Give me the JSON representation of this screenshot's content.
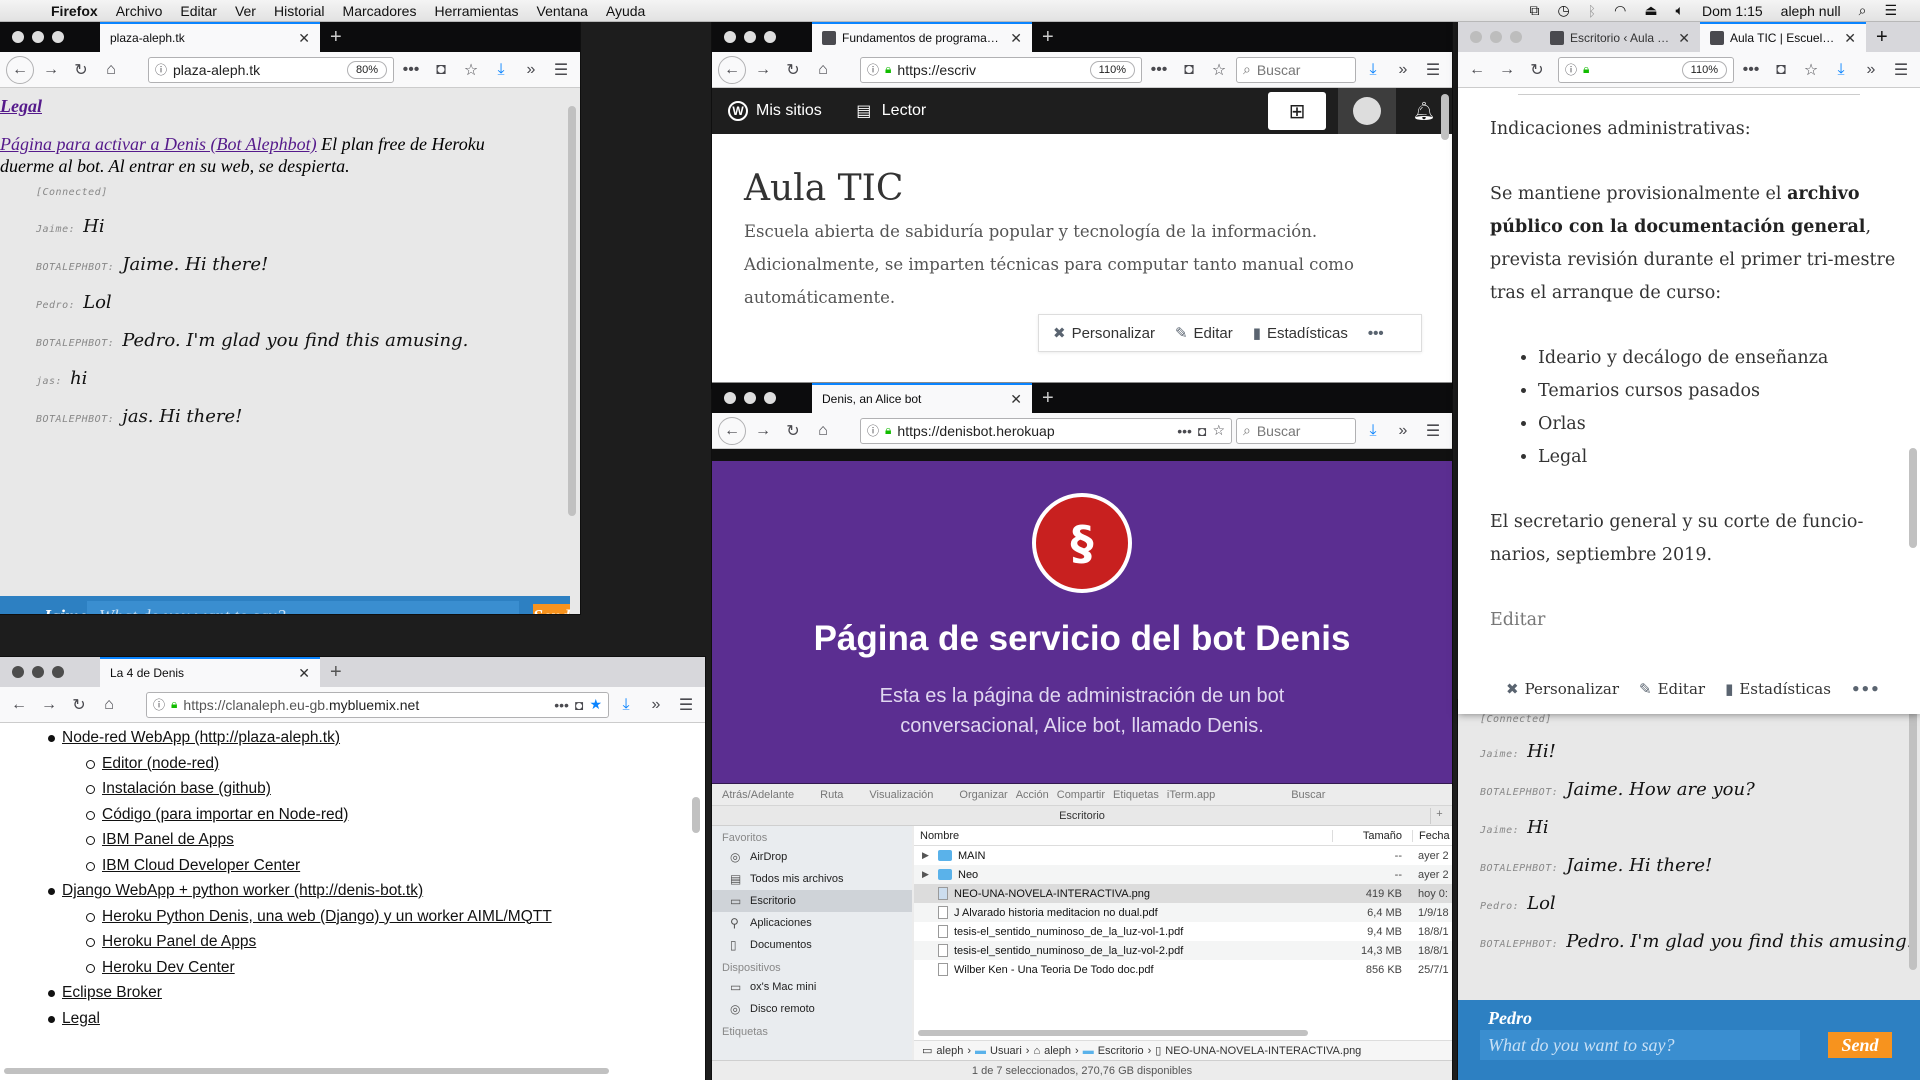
{
  "menubar": {
    "app": "Firefox",
    "items": [
      "Archivo",
      "Editar",
      "Ver",
      "Historial",
      "Marcadores",
      "Herramientas",
      "Ventana",
      "Ayuda"
    ],
    "clock": "Dom 1:15",
    "user": "aleph null"
  },
  "win_chat_left": {
    "tab": "plaza-aleph.tk",
    "url": "plaza-aleph.tk",
    "zoom": "80%",
    "legal_link": "Legal",
    "activate_link": "Página para activar a Denis (Bot Alephbot)",
    "note": " El plan free de Heroku duerme al bot. Al entrar en su web, se despierta.",
    "connected": "[Connected]",
    "messages": [
      {
        "nick": "Jaime:",
        "text": "Hi"
      },
      {
        "nick": "BOTALEPHBOT:",
        "text": "Jaime. Hi there!"
      },
      {
        "nick": "Pedro:",
        "text": "Lol"
      },
      {
        "nick": "BOTALEPHBOT:",
        "text": "Pedro. I'm glad you find this amusing."
      },
      {
        "nick": "jas:",
        "text": "hi"
      },
      {
        "nick": "BOTALEPHBOT:",
        "text": "jas. Hi there!"
      }
    ],
    "form": {
      "nick": "Jaime",
      "placeholder": "What do you want to say?",
      "send": "Send"
    }
  },
  "win_wp": {
    "tab": "Fundamentos de programación",
    "url": "https://escriv",
    "zoom": "110%",
    "search": "Buscar",
    "bar": {
      "my_sites": "Mis sitios",
      "reader": "Lector"
    },
    "title": "Aula TIC",
    "desc": "Escuela abierta de sabiduría popular y tecnología de la información. Adicionalmente, se imparten técnicas para computar tanto manual como automáticamente.",
    "footer": {
      "customize": "Personalizar",
      "edit": "Editar",
      "stats": "Estadísticas"
    }
  },
  "win_denis": {
    "tab": "Denis, an Alice bot",
    "url": "https://denisbot.herokuap",
    "search": "Buscar",
    "heading": "Página de servicio del bot Denis",
    "sub": "Esta es la página de administración de un bot conversacional, Alice bot, llamado Denis."
  },
  "win_finder": {
    "toolbar": [
      "Atrás/Adelante",
      "Ruta",
      "Visualización",
      "Organizar",
      "Acción",
      "Compartir",
      "Etiquetas",
      "iTerm.app",
      "Buscar"
    ],
    "title": "Escritorio",
    "sidebar": {
      "favorites_header": "Favoritos",
      "favorites": [
        "AirDrop",
        "Todos mis archivos",
        "Escritorio",
        "Aplicaciones",
        "Documentos"
      ],
      "devices_header": "Dispositivos",
      "devices": [
        "ox's Mac mini",
        "Disco remoto"
      ],
      "tags_header": "Etiquetas"
    },
    "columns": {
      "name": "Nombre",
      "size": "Tamaño",
      "date": "Fecha"
    },
    "rows": [
      {
        "name": "MAIN",
        "size": "--",
        "date": "ayer 2",
        "type": "folder"
      },
      {
        "name": "Neo",
        "size": "--",
        "date": "ayer 2",
        "type": "folder"
      },
      {
        "name": "NEO-UNA-NOVELA-INTERACTIVA.png",
        "size": "419 KB",
        "date": "hoy 0:",
        "type": "img"
      },
      {
        "name": "J Alvarado historia meditacion no dual.pdf",
        "size": "6,4 MB",
        "date": "1/9/18",
        "type": "doc"
      },
      {
        "name": "tesis-el_sentido_numinoso_de_la_luz-vol-1.pdf",
        "size": "9,4 MB",
        "date": "18/8/1",
        "type": "doc"
      },
      {
        "name": "tesis-el_sentido_numinoso_de_la_luz-vol-2.pdf",
        "size": "14,3 MB",
        "date": "18/8/1",
        "type": "doc"
      },
      {
        "name": "Wilber Ken - Una Teoria De Todo doc.pdf",
        "size": "856 KB",
        "date": "25/7/1",
        "type": "doc"
      }
    ],
    "breadcrumb": [
      "aleph",
      "Usuari",
      "aleph",
      "Escritorio",
      "NEO-UNA-NOVELA-INTERACTIVA.png"
    ],
    "status": "1 de 7 seleccionados, 270,76 GB disponibles"
  },
  "win_links": {
    "tab": "La 4 de Denis",
    "url_pre": "https://clanaleph.eu-gb.",
    "url_host": "mybluemix.net",
    "items": [
      {
        "level": 1,
        "text": "Node-red WebApp (http://plaza-aleph.tk)"
      },
      {
        "level": 2,
        "text": "Editor (node-red)"
      },
      {
        "level": 2,
        "text": "Instalación base (github)"
      },
      {
        "level": 2,
        "text": "Código (para importar en Node-red)"
      },
      {
        "level": 2,
        "text": "IBM Panel de Apps"
      },
      {
        "level": 2,
        "text": "IBM Cloud Developer Center"
      },
      {
        "level": 1,
        "text": "Django WebApp + python worker (http://denis-bot.tk)"
      },
      {
        "level": 2,
        "text": "Heroku Python Denis, una web (Django) y un worker AIML/MQTT"
      },
      {
        "level": 2,
        "text": "Heroku Panel de Apps"
      },
      {
        "level": 2,
        "text": "Heroku Dev Center"
      },
      {
        "level": 1,
        "text": "Eclipse Broker"
      },
      {
        "level": 1,
        "text": "Legal"
      }
    ]
  },
  "win_right": {
    "tab1": "Escritorio ‹ Aula TIC",
    "tab2": "Aula TIC | Escuela a",
    "zoom": "110%",
    "p1": "Indicaciones administrativas:",
    "p2a": "Se mantiene provisionalmente el ",
    "p2b": "archivo público con la documentación general",
    "p2c": ", prevista revisión durante el primer tri-mestre tras el arranque de curso:",
    "bullets": [
      "Ideario y decálogo de enseñanza",
      "Temarios cursos pasados",
      "Orlas",
      "Legal"
    ],
    "p3": "El secretario general y su corte de funcio-narios, septiembre 2019.",
    "edit": "Editar",
    "footer": {
      "customize": "Personalizar",
      "edit": "Editar",
      "stats": "Estadísticas"
    }
  },
  "chat_right": {
    "connected": "[Connected]",
    "messages": [
      {
        "nick": "Jaime:",
        "text": "Hi!"
      },
      {
        "nick": "BOTALEPHBOT:",
        "text": "Jaime. How are you?"
      },
      {
        "nick": "Jaime:",
        "text": "Hi"
      },
      {
        "nick": "BOTALEPHBOT:",
        "text": "Jaime. Hi there!"
      },
      {
        "nick": "Pedro:",
        "text": "Lol"
      },
      {
        "nick": "BOTALEPHBOT:",
        "text": "Pedro. I'm glad you find this amusing."
      }
    ],
    "form": {
      "nick": "Pedro",
      "placeholder": "What do you want to say?",
      "send": "Send"
    }
  }
}
